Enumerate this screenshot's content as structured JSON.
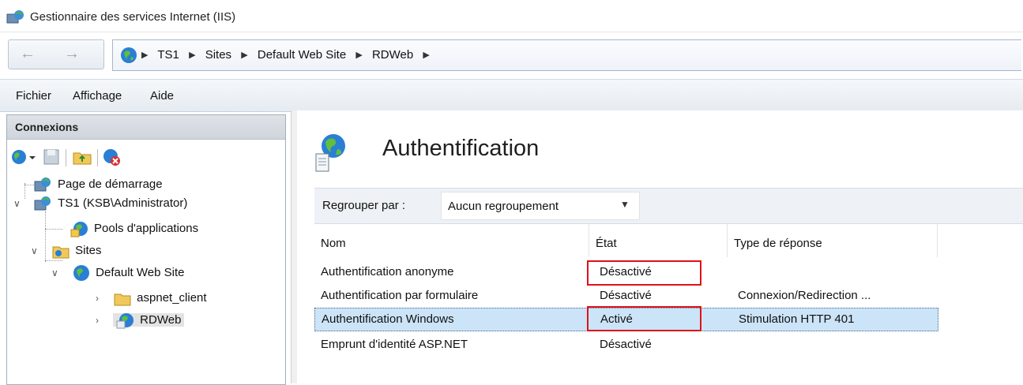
{
  "window": {
    "title": "Gestionnaire des services Internet (IIS)"
  },
  "address_bar": {
    "crumbs": [
      "TS1",
      "Sites",
      "Default Web Site",
      "RDWeb"
    ]
  },
  "menu": {
    "items": [
      "Fichier",
      "Affichage",
      "Aide"
    ]
  },
  "connections": {
    "header": "Connexions",
    "tree": [
      {
        "label": "Page de démarrage",
        "icon": "server-icon"
      },
      {
        "label": "TS1 (KSB\\Administrator)",
        "icon": "server-icon"
      },
      {
        "label": "Pools d'applications",
        "icon": "app-pool-icon"
      },
      {
        "label": "Sites",
        "icon": "sites-folder-icon"
      },
      {
        "label": "Default Web Site",
        "icon": "globe-icon"
      },
      {
        "label": "aspnet_client",
        "icon": "folder-icon"
      },
      {
        "label": "RDWeb",
        "icon": "web-app-icon",
        "selected": true
      }
    ]
  },
  "feature": {
    "title": "Authentification",
    "group_by_label": "Regrouper par :",
    "group_by_value": "Aucun regroupement",
    "columns": [
      "Nom",
      "État",
      "Type de réponse"
    ],
    "rows": [
      {
        "name": "Authentification anonyme",
        "state": "Désactivé",
        "response": "",
        "highlight_state": true
      },
      {
        "name": "Authentification par formulaire",
        "state": "Désactivé",
        "response": "Connexion/Redirection ..."
      },
      {
        "name": "Authentification Windows",
        "state": "Activé",
        "response": "Stimulation HTTP 401",
        "selected": true,
        "highlight_state": true
      },
      {
        "name": "Emprunt d'identité ASP.NET",
        "state": "Désactivé",
        "response": ""
      }
    ]
  },
  "colors": {
    "selection": "#cce4f7",
    "annotation": "#e0101a"
  }
}
